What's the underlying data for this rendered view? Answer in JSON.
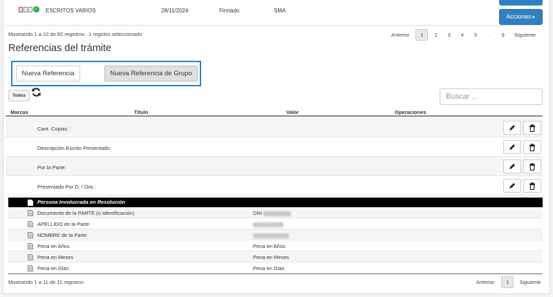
{
  "top_row": {
    "doc_name": "ESCRITOS VARIOS",
    "date": "28/11/2024",
    "status": "Firmado",
    "user": "SMA",
    "actions_label": "Acciones"
  },
  "pagination_top": {
    "summary": "Mostrando 1 a 10 de 82 registros",
    "selected": "1 registro seleccionado",
    "prev": "Anterior",
    "pages": [
      "1",
      "2",
      "3",
      "4",
      "5",
      "…",
      "9"
    ],
    "next": "Siguiente"
  },
  "section_title": "Referencias del trámite",
  "buttons": {
    "new_ref": "Nueva Referencia",
    "new_group_ref": "Nueva Referencia de Grupo",
    "todos": "Todos"
  },
  "search": {
    "placeholder": "Buscar ..."
  },
  "columns": [
    "Marcas",
    "Título",
    "Valor",
    "Operaciones"
  ],
  "references": [
    "Cant. Copias :",
    "Descripción Escrito Presentado:",
    "Por la Parte:",
    "Presentado Por D. / Dra.:"
  ],
  "group": {
    "title": "Persona Involucrada en Resolución",
    "rows": [
      {
        "label": "Documento de la PARTE (o Identificación)",
        "value": "DNI"
      },
      {
        "label": "APELLIDO de la Parte",
        "value": ""
      },
      {
        "label": "NOMBRE de la Parte",
        "value": ""
      },
      {
        "label": "Pena en Años",
        "value": "Pena en Años"
      },
      {
        "label": "Pena en Meses",
        "value": "Pena en Meses"
      },
      {
        "label": "Pena en Días",
        "value": "Pena en Días"
      }
    ]
  },
  "pagination_bottom": {
    "summary": "Mostrando 1 a 11 de 11 registros",
    "prev": "Anterior",
    "page": "1",
    "next": "Siguiente"
  },
  "colors": {
    "accent": "#2f7fc1",
    "group_bg": "#000000"
  }
}
